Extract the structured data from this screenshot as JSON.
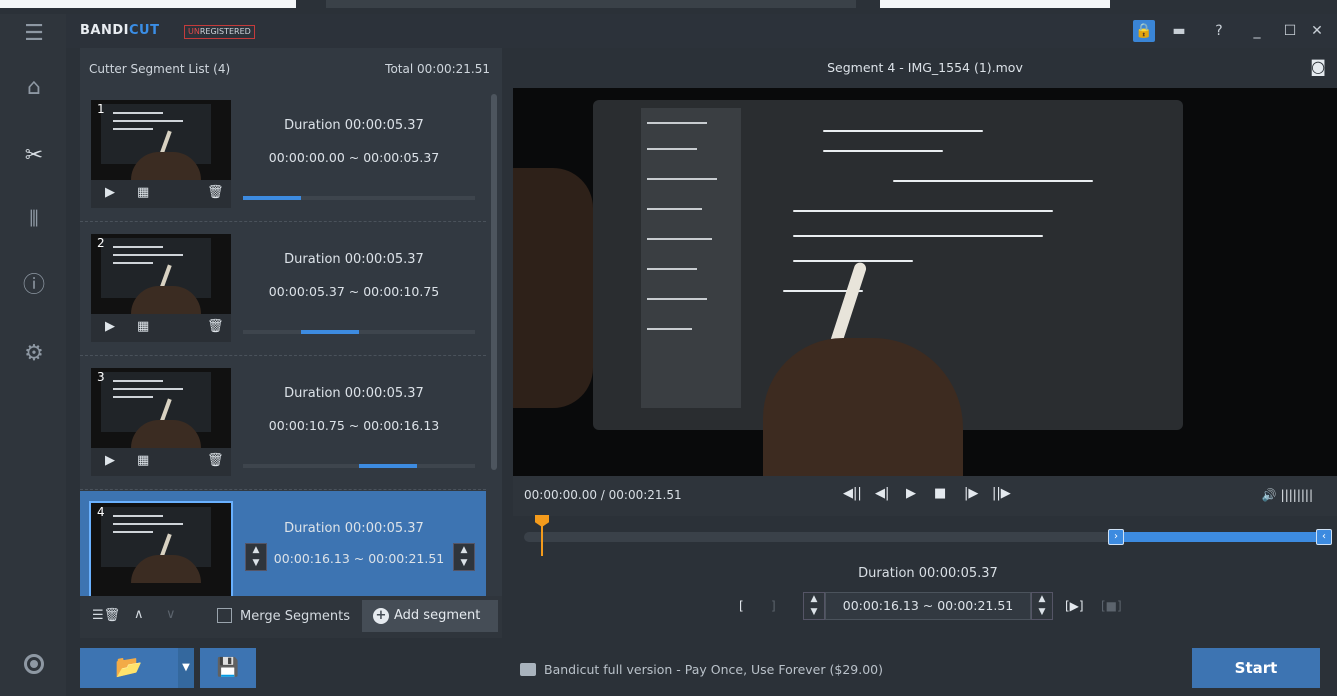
{
  "app": {
    "logo_main": "BANDI",
    "logo_cut": "CUT",
    "unregistered_un": "UN",
    "unregistered_rest": "REGISTERED"
  },
  "header_buttons": {
    "help": "?",
    "minimize": "_",
    "maximize": "☐",
    "close": "✕"
  },
  "segment_list": {
    "title": "Cutter Segment List (4)",
    "total": "Total 00:00:21.51",
    "items": [
      {
        "num": "1",
        "duration": "Duration 00:00:05.37",
        "range": "00:00:00.00 ~ 00:00:05.37"
      },
      {
        "num": "2",
        "duration": "Duration 00:00:05.37",
        "range": "00:00:05.37 ~ 00:00:10.75"
      },
      {
        "num": "3",
        "duration": "Duration 00:00:05.37",
        "range": "00:00:10.75 ~ 00:00:16.13"
      },
      {
        "num": "4",
        "duration": "Duration 00:00:05.37",
        "range": "00:00:16.13 ~ 00:00:21.51"
      }
    ],
    "merge_label": "Merge Segments",
    "add_label": "Add segment"
  },
  "preview": {
    "title": "Segment 4 - IMG_1554 (1).mov",
    "time": "00:00:00.00 / 00:00:21.51",
    "duration": "Duration 00:00:05.37",
    "range": "00:00:16.13 ~ 00:00:21.51"
  },
  "bottom": {
    "promo": "Bandicut full version - Pay Once, Use Forever ($29.00)",
    "start": "Start"
  },
  "colors": {
    "accent": "#3d74b2",
    "playhead": "#f49b1c",
    "highlight": "#3d8be0"
  }
}
